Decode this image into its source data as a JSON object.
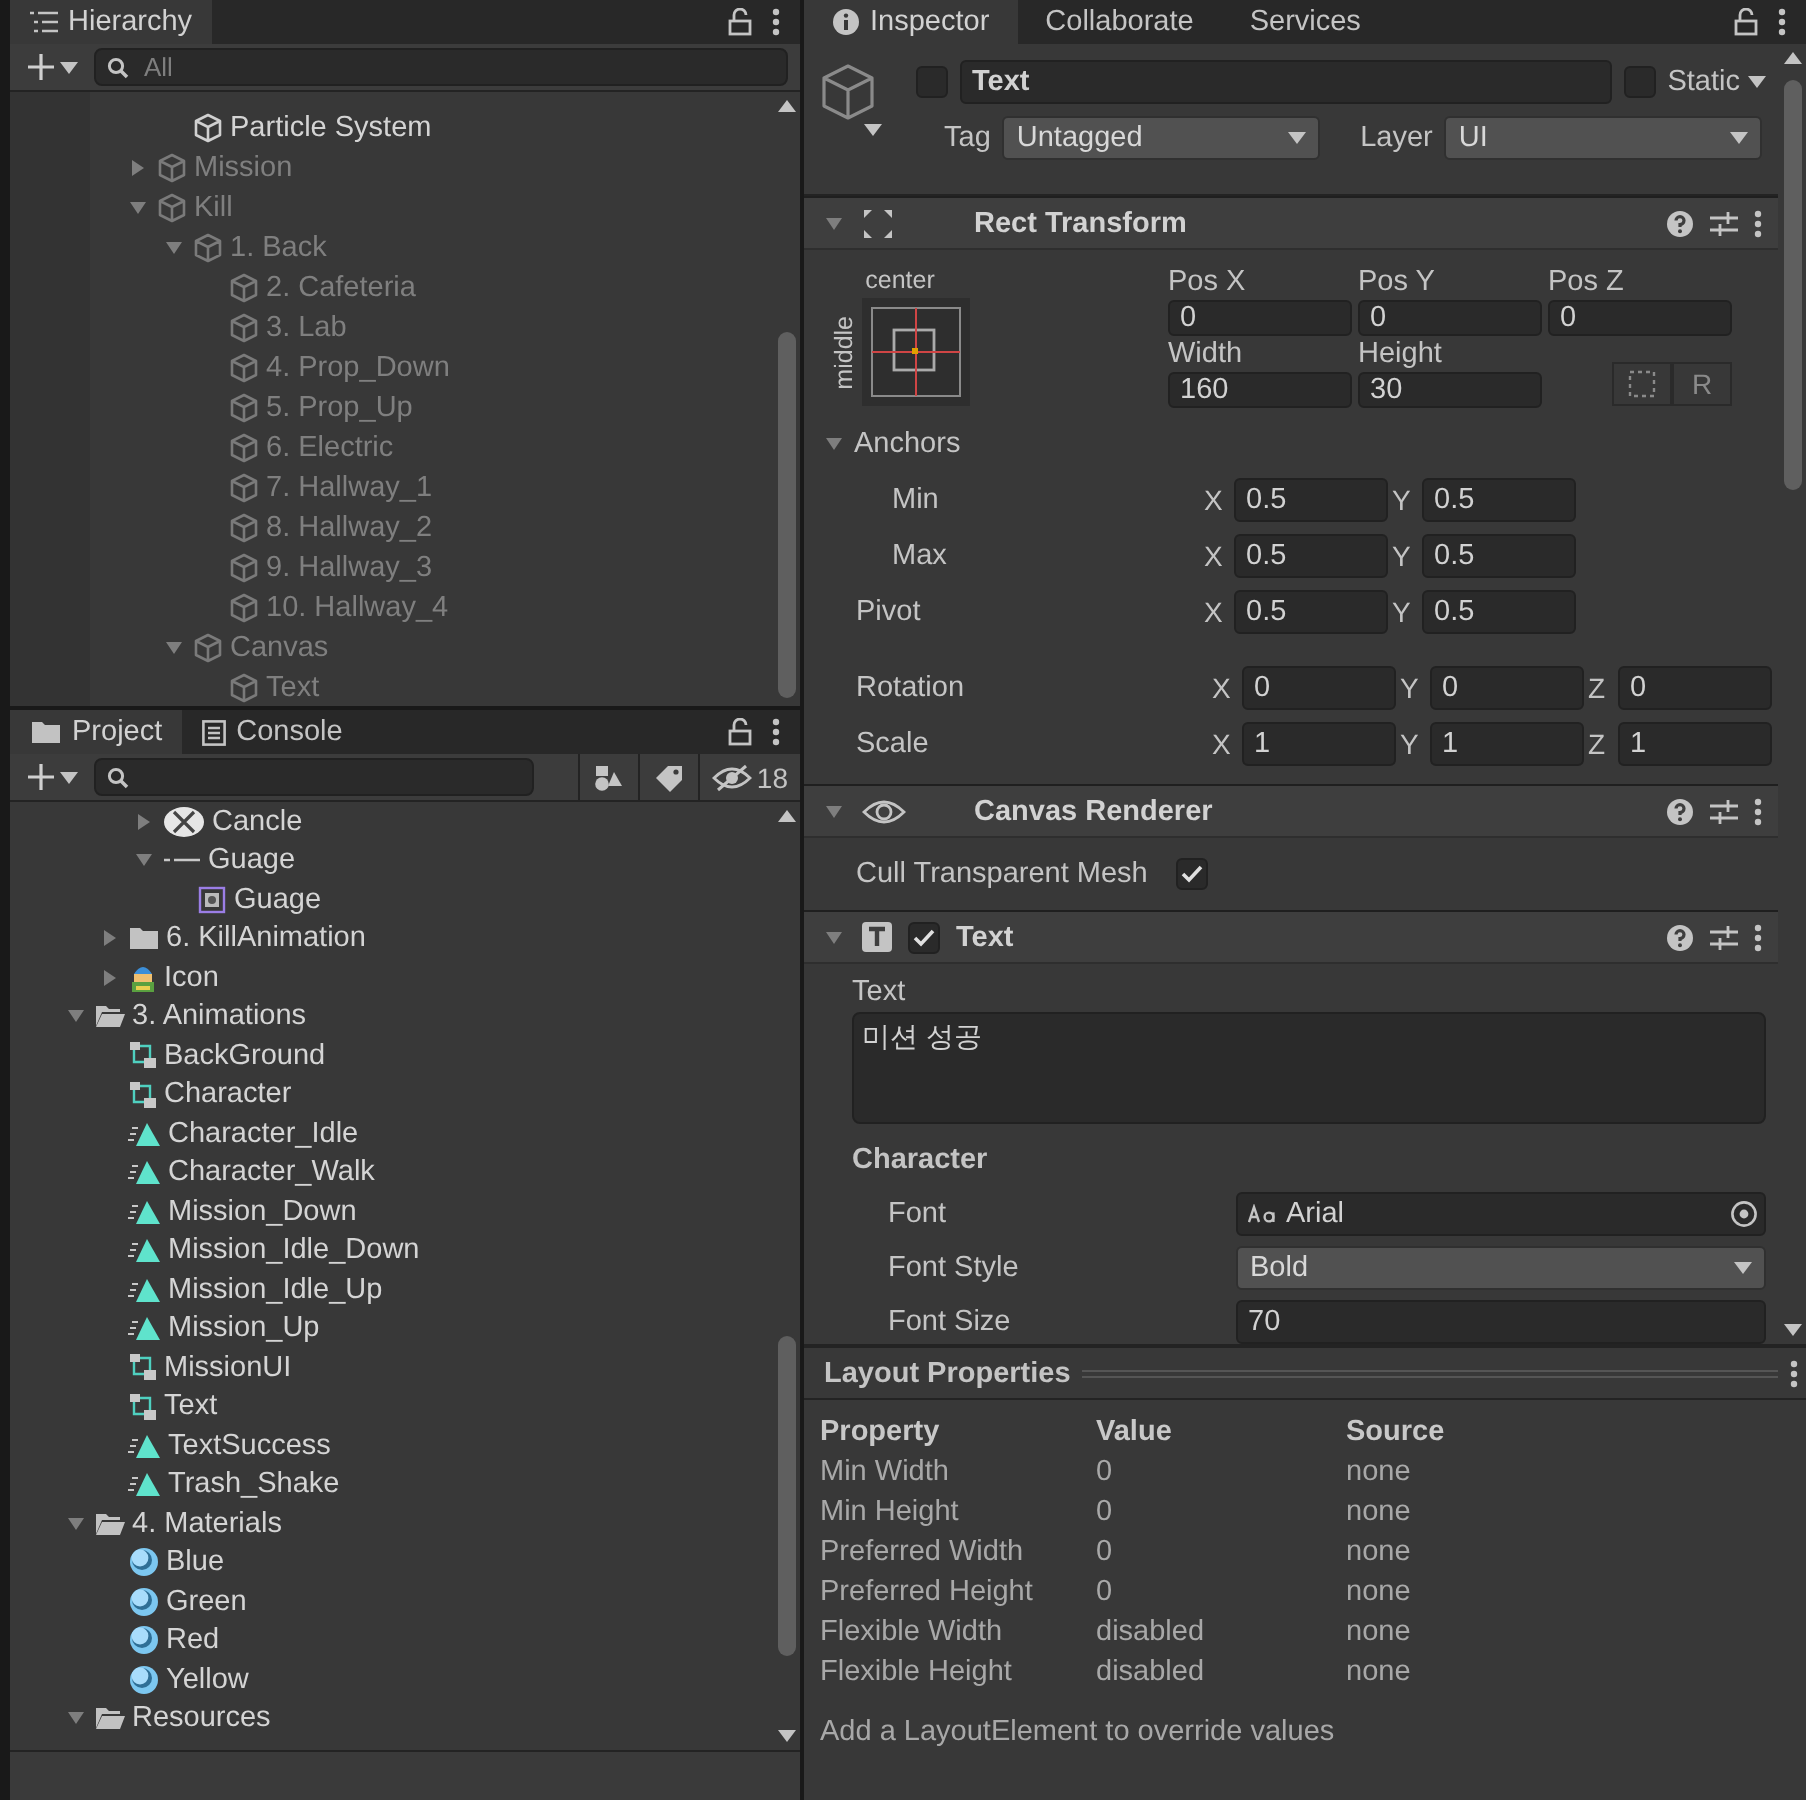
{
  "hierarchy": {
    "tabs": [
      {
        "label": "Hierarchy",
        "selected": true
      }
    ],
    "search_placeholder": "All",
    "items": [
      {
        "children": [
          {
            "label": "Particle System",
            "inactive": false
          }
        ]
      },
      {
        "label": "Mission",
        "inactive": true,
        "expanded": false
      },
      {
        "label": "Kill",
        "inactive": true,
        "expanded": true,
        "children": [
          {
            "label": "1. Back",
            "inactive": true,
            "expanded": true,
            "children": [
              {
                "label": "2. Cafeteria",
                "inactive": true
              },
              {
                "label": "3. Lab",
                "inactive": true
              },
              {
                "label": "4. Prop_Down",
                "inactive": true
              },
              {
                "label": "5. Prop_Up",
                "inactive": true
              },
              {
                "label": "6. Electric",
                "inactive": true
              },
              {
                "label": "7. Hallway_1",
                "inactive": true
              },
              {
                "label": "8. Hallway_2",
                "inactive": true
              },
              {
                "label": "9. Hallway_3",
                "inactive": true
              },
              {
                "label": "10. Hallway_4",
                "inactive": true
              }
            ]
          },
          {
            "label": "Canvas",
            "inactive": true,
            "expanded": true,
            "children": [
              {
                "label": "Text",
                "inactive": true
              }
            ]
          }
        ]
      }
    ]
  },
  "project": {
    "tabs": [
      {
        "label": "Project",
        "selected": true,
        "kind": "folder"
      },
      {
        "label": "Console",
        "selected": false,
        "kind": "console"
      }
    ],
    "hidden_count": "18",
    "items": [
      {
        "children": [
          {
            "children": [
              {
                "label": "Cancle",
                "kind": "sprite",
                "expanded": false
              },
              {
                "label": "Guage",
                "kind": "line",
                "expanded": true,
                "children": [
                  {
                    "label": "Guage",
                    "kind": "rect-sprite"
                  }
                ]
              }
            ]
          },
          {
            "label": "6. KillAnimation",
            "kind": "folder",
            "expanded": false
          },
          {
            "label": "Icon",
            "kind": "character",
            "expanded": false
          }
        ]
      },
      {
        "label": "3. Animations",
        "kind": "folder",
        "expanded": true,
        "children": [
          {
            "label": "BackGround",
            "kind": "controller"
          },
          {
            "label": "Character",
            "kind": "controller"
          },
          {
            "label": "Character_Idle",
            "kind": "clip"
          },
          {
            "label": "Character_Walk",
            "kind": "clip"
          },
          {
            "label": "Mission_Down",
            "kind": "clip"
          },
          {
            "label": "Mission_Idle_Down",
            "kind": "clip"
          },
          {
            "label": "Mission_Idle_Up",
            "kind": "clip"
          },
          {
            "label": "Mission_Up",
            "kind": "clip"
          },
          {
            "label": "MissionUI",
            "kind": "controller"
          },
          {
            "label": "Text",
            "kind": "controller"
          },
          {
            "label": "TextSuccess",
            "kind": "clip"
          },
          {
            "label": "Trash_Shake",
            "kind": "clip"
          }
        ]
      },
      {
        "label": "4. Materials",
        "kind": "folder",
        "expanded": true,
        "children": [
          {
            "label": "Blue",
            "kind": "material"
          },
          {
            "label": "Green",
            "kind": "material"
          },
          {
            "label": "Red",
            "kind": "material"
          },
          {
            "label": "Yellow",
            "kind": "material"
          }
        ]
      },
      {
        "label": "Resources",
        "kind": "folder",
        "expanded": true
      }
    ]
  },
  "inspector": {
    "tabs": [
      {
        "label": "Inspector",
        "selected": true
      },
      {
        "label": "Collaborate",
        "selected": false
      },
      {
        "label": "Services",
        "selected": false
      }
    ],
    "object": {
      "active": false,
      "name": "Text",
      "static": false,
      "static_label": "Static",
      "tag_label": "Tag",
      "tag": "Untagged",
      "layer_label": "Layer",
      "layer": "UI"
    },
    "rect_transform": {
      "title": "Rect Transform",
      "expanded": true,
      "anchor_horizontal": "center",
      "anchor_vertical": "middle",
      "fields": [
        {
          "label": "Pos X",
          "value": "0"
        },
        {
          "label": "Pos Y",
          "value": "0"
        },
        {
          "label": "Pos Z",
          "value": "0"
        },
        {
          "label": "Width",
          "value": "160"
        },
        {
          "label": "Height",
          "value": "30"
        }
      ],
      "raw_button": "R",
      "anchors": {
        "label": "Anchors",
        "expanded": true,
        "rows": [
          {
            "label": "Min",
            "values": [
              {
                "axis": "X",
                "value": "0.5"
              },
              {
                "axis": "Y",
                "value": "0.5"
              }
            ]
          },
          {
            "label": "Max",
            "values": [
              {
                "axis": "X",
                "value": "0.5"
              },
              {
                "axis": "Y",
                "value": "0.5"
              }
            ]
          }
        ]
      },
      "rows": [
        {
          "label": "Pivot",
          "values": [
            {
              "axis": "X",
              "value": "0.5"
            },
            {
              "axis": "Y",
              "value": "0.5"
            }
          ]
        },
        {
          "label": "Rotation",
          "values": [
            {
              "axis": "X",
              "value": "0"
            },
            {
              "axis": "Y",
              "value": "0"
            },
            {
              "axis": "Z",
              "value": "0"
            }
          ]
        },
        {
          "label": "Scale",
          "values": [
            {
              "axis": "X",
              "value": "1"
            },
            {
              "axis": "Y",
              "value": "1"
            },
            {
              "axis": "Z",
              "value": "1"
            }
          ]
        }
      ]
    },
    "canvas_renderer": {
      "title": "Canvas Renderer",
      "expanded": true,
      "fields": [
        {
          "label": "Cull Transparent Mesh",
          "checked": true
        }
      ]
    },
    "text_component": {
      "title": "Text",
      "enabled": true,
      "expanded": true,
      "text_label": "Text",
      "text": "미션 성공",
      "section": "Character",
      "font_label": "Font",
      "font": "Arial",
      "font_style_label": "Font Style",
      "font_style": "Bold",
      "font_size_label": "Font Size",
      "font_size": "70"
    },
    "layout_properties": {
      "title": "Layout Properties",
      "columns": [
        "Property",
        "Value",
        "Source"
      ],
      "rows": [
        [
          "Min Width",
          "0",
          "none"
        ],
        [
          "Min Height",
          "0",
          "none"
        ],
        [
          "Preferred Width",
          "0",
          "none"
        ],
        [
          "Preferred Height",
          "0",
          "none"
        ],
        [
          "Flexible Width",
          "disabled",
          "none"
        ],
        [
          "Flexible Height",
          "disabled",
          "none"
        ]
      ],
      "note": "Add a LayoutElement to override values"
    }
  }
}
